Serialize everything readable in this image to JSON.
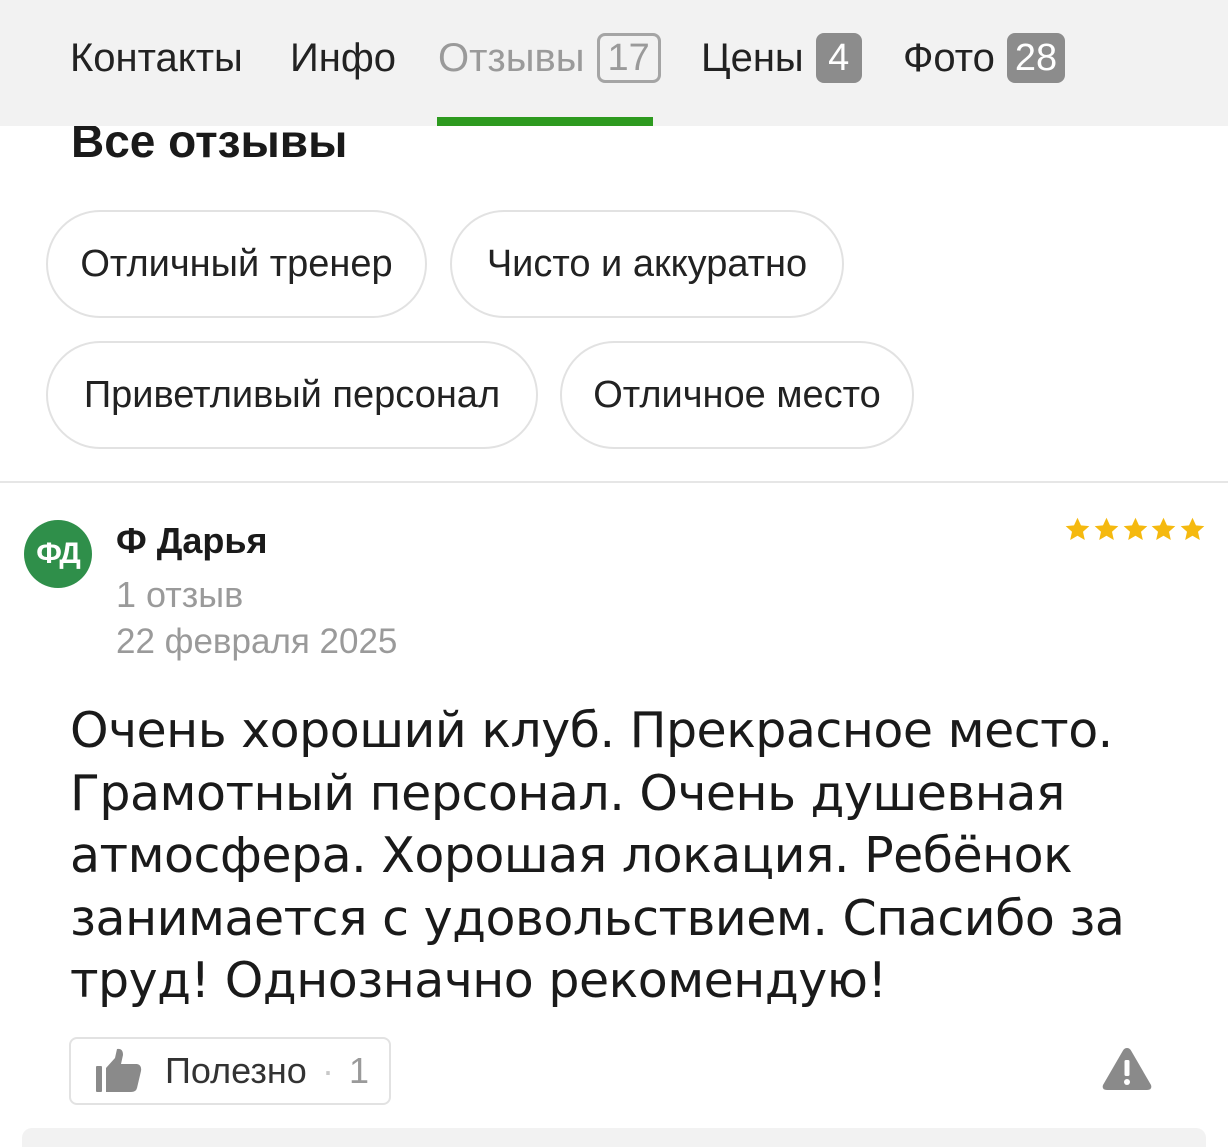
{
  "tabs": [
    {
      "label": "Контакты",
      "badge": ""
    },
    {
      "label": "Инфо",
      "badge": ""
    },
    {
      "label": "Отзывы",
      "badge": "17",
      "active": true
    },
    {
      "label": "Цены",
      "badge": "4"
    },
    {
      "label": "Фото",
      "badge": "28"
    }
  ],
  "section": {
    "title": "Все отзывы"
  },
  "chips": [
    "Отличный тренер",
    "Чисто и аккуратно",
    "Приветливый персонал",
    "Отличное место"
  ],
  "review": {
    "avatar_initials": "ФД",
    "author": "Ф Дарья",
    "author_reviews": "1 отзыв",
    "date": "22 февраля 2025",
    "rating": 5,
    "text": "Очень хороший клуб. Прекрасное место. Грамотный персонал. Очень душевная атмосфера. Хорошая локация. Ребёнок занимается с удовольствием. Спасибо за труд! Однозначно рекомендую!",
    "useful_label": "Полезно",
    "useful_separator": "·",
    "useful_count": "1"
  },
  "icons": {
    "like": "thumbs-up-icon",
    "report": "warning-icon",
    "rating": "star-icon"
  },
  "colors": {
    "accent": "#2d9a1f",
    "avatar": "#2f8f4a",
    "star": "#f5b90f",
    "badge": "#8c8c8c"
  }
}
